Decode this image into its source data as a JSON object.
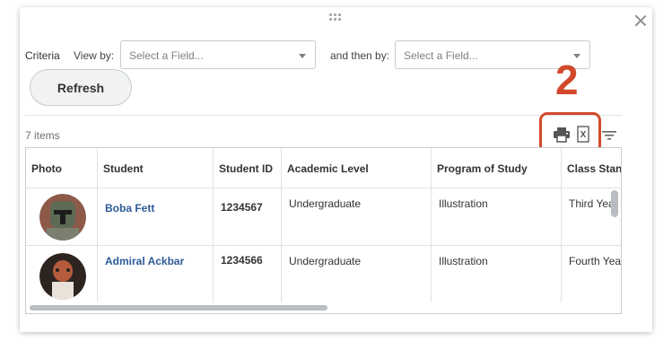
{
  "criteria": {
    "label": "Criteria",
    "view_by_label": "View by:",
    "view_by_placeholder": "Select a Field...",
    "then_by_label": "and then by:",
    "then_by_placeholder": "Select a Field..."
  },
  "refresh_label": "Refresh",
  "items_count": "7 items",
  "callout_number": "2",
  "colors": {
    "accent": "#d14a2b",
    "link": "#2d5b97"
  },
  "toolbar": {
    "icons": [
      "print-icon",
      "excel-icon",
      "filter-icon"
    ]
  },
  "table": {
    "columns": [
      "Photo",
      "Student",
      "Student ID",
      "Academic Level",
      "Program of Study",
      "Class Standing"
    ],
    "rows": [
      {
        "student": "Boba Fett",
        "student_id": "1234567",
        "academic_level": "Undergraduate",
        "program": "Illustration",
        "class_standing": "Third Year"
      },
      {
        "student": "Admiral Ackbar",
        "student_id": "1234566",
        "academic_level": "Undergraduate",
        "program": "Illustration",
        "class_standing": "Fourth Year"
      }
    ]
  }
}
